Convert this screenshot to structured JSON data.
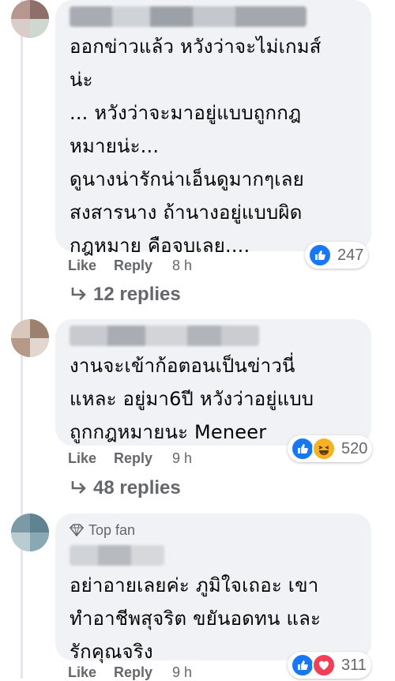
{
  "colors": {
    "bubble": "#f0f2f5",
    "meta_text": "#65676b",
    "like_blue": "#1877f2",
    "love_red": "#f33e58",
    "haha_yellow": "#f7b125"
  },
  "comments": [
    {
      "badge": "",
      "text": "ออกข่าวแล้ว หวังว่าจะไม่เกมส์\nน่ะ\n... หวังว่าจะมาอยู่แบบถูกกฎ\nหมายน่ะ...\nดูนางน่ารักน่าเอ็นดูมากๆเลย\nสงสารนาง ถ้านางอยู่แบบผิด\nกฎหมาย คือจบเลย....",
      "like_label": "Like",
      "reply_label": "Reply",
      "time": "8 h",
      "reactions": [
        "like-icon"
      ],
      "reaction_count": "247",
      "replies_label": "12 replies"
    },
    {
      "badge": "",
      "text": "งานจะเข้าก้อตอนเป็นข่าวนี่\nแหละ อยู่มา6ปี หวังว่าอยู่แบบ\nถูกกฎหมายนะ Meneer",
      "like_label": "Like",
      "reply_label": "Reply",
      "time": "9 h",
      "reactions": [
        "like-icon",
        "haha-icon"
      ],
      "reaction_count": "520",
      "replies_label": "48 replies"
    },
    {
      "badge": "Top fan",
      "text": "อย่าอายเลยค่ะ ภูมิใจเถอะ เขา\nทำอาชีพสุจริต ขยันอดทน และ\nรักคุณจริง",
      "like_label": "Like",
      "reply_label": "Reply",
      "time": "9 h",
      "reactions": [
        "like-icon",
        "love-icon"
      ],
      "reaction_count": "311",
      "replies_label": ""
    }
  ]
}
